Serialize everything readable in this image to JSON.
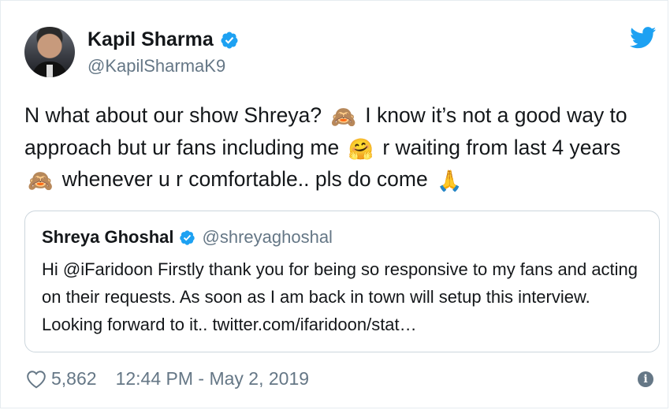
{
  "author": {
    "name": "Kapil Sharma",
    "handle": "@KapilSharmaK9"
  },
  "tweet": {
    "seg1": "N what about our show Shreya?",
    "emoji1": "🙈",
    "seg2": "I know it’s not a good way to approach but ur fans including me",
    "emoji2": "🤗",
    "seg3": "r waiting from last 4 years",
    "emoji3": "🙈",
    "seg4": "whenever u r comfortable.. pls do come",
    "emoji4": "🙏"
  },
  "quoted": {
    "name": "Shreya Ghoshal",
    "handle": "@shreyaghoshal",
    "text": "Hi @iFaridoon Firstly thank you for being so responsive to my fans and acting on their requests. As soon as I am back in town will setup this interview. Looking forward to it.. twitter.com/ifaridoon/stat…"
  },
  "footer": {
    "likes": "5,862",
    "timestamp": "12:44 PM - May 2, 2019",
    "info_glyph": "i"
  },
  "colors": {
    "twitter_blue": "#1da1f2",
    "secondary_text": "#657786",
    "border": "#ccd6dd"
  },
  "icons": [
    "verified-icon",
    "twitter-bird-icon",
    "heart-icon",
    "info-icon"
  ]
}
